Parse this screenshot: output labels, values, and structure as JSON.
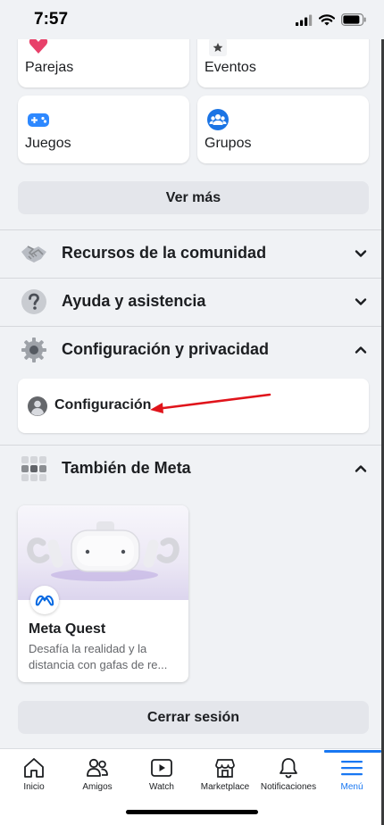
{
  "status_bar": {
    "time": "7:57"
  },
  "shortcuts": [
    {
      "label": "Parejas"
    },
    {
      "label": "Eventos"
    },
    {
      "label": "Juegos"
    },
    {
      "label": "Grupos"
    }
  ],
  "see_more": "Ver más",
  "sections": {
    "community": "Recursos de la comunidad",
    "help": "Ayuda y asistencia",
    "settings_privacy": "Configuración y privacidad",
    "settings": "Configuración",
    "also_from_meta": "También de Meta"
  },
  "meta_card": {
    "title": "Meta Quest",
    "description": "Desafía la realidad y la distancia con gafas de re..."
  },
  "logout": "Cerrar sesión",
  "nav": [
    {
      "label": "Inicio"
    },
    {
      "label": "Amigos"
    },
    {
      "label": "Watch"
    },
    {
      "label": "Marketplace"
    },
    {
      "label": "Notificaciones"
    },
    {
      "label": "Menú",
      "active": true
    }
  ],
  "colors": {
    "accent": "#1877f2",
    "annotation_arrow": "#e0141b"
  }
}
